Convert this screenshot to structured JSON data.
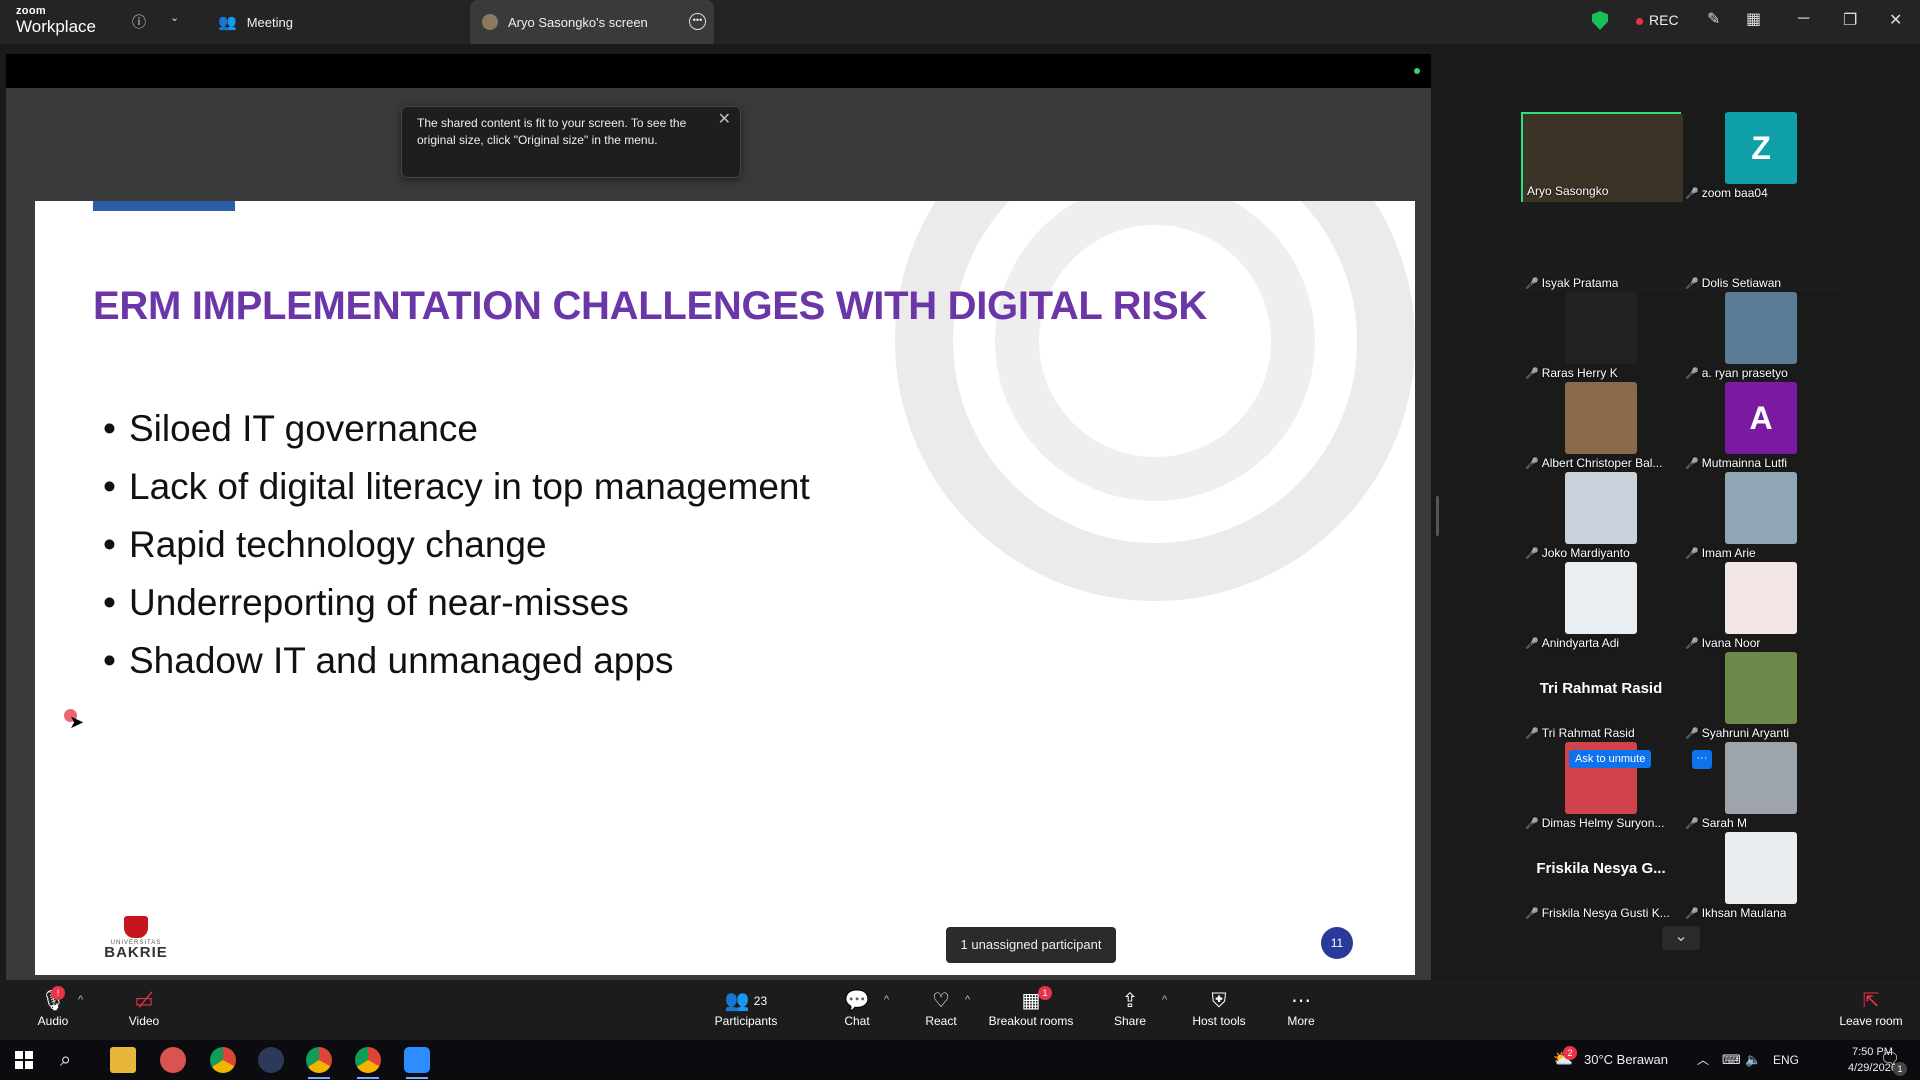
{
  "app": {
    "logo_line1": "zoom",
    "logo_line2": "Workplace",
    "info_icon": "info-icon",
    "tab_meeting": "Meeting",
    "tab_screen": "Aryo Sasongko's screen",
    "rec_label": "REC"
  },
  "toast": {
    "message": "The shared content is fit to your screen. To see the original size, click \"Original size\" in the menu."
  },
  "slide": {
    "title": "ERM IMPLEMENTATION CHALLENGES WITH DIGITAL RISK",
    "bullets": [
      "Siloed IT governance",
      "Lack of digital literacy in top management",
      "Rapid technology change",
      "Underreporting of near-misses",
      "Shadow IT and unmanaged apps"
    ],
    "logo_upper": "UNIVERSITAS",
    "logo_lower": "BAKRIE",
    "page_number": "11",
    "colors": {
      "title": "#6b36a8",
      "accent_bar": "#2e5da8"
    }
  },
  "gallery": {
    "participants": [
      {
        "name": "Aryo Sasongko",
        "active": true
      },
      {
        "name": "zoom baa04",
        "initial": "Z"
      },
      {
        "name": "Isyak Pratama"
      },
      {
        "name": "Dolis Setiawan"
      },
      {
        "name": "Raras Herry K"
      },
      {
        "name": "a. ryan prasetyo"
      },
      {
        "name": "Albert Christoper Bal..."
      },
      {
        "name": "Mutmainna Lutfi",
        "initial": "A"
      },
      {
        "name": "Joko Mardiyanto"
      },
      {
        "name": "Imam Arie"
      },
      {
        "name": "Anindyarta Adi"
      },
      {
        "name": "Ivana Noor"
      },
      {
        "name": "Tri Rahmat Rasid",
        "display_name": "Tri Rahmat Rasid"
      },
      {
        "name": "Syahruni Aryanti"
      },
      {
        "name": "Dimas Helmy Suryon..."
      },
      {
        "name": "Sarah M"
      },
      {
        "name": "Friskila Nesya Gusti K...",
        "display_name": "Friskila Nesya G..."
      },
      {
        "name": "Ikhsan Maulana"
      }
    ],
    "ask_to_unmute": "Ask to unmute",
    "more_dots": "···"
  },
  "unassigned": "1 unassigned participant",
  "toolbar": {
    "audio": "Audio",
    "video": "Video",
    "participants": "Participants",
    "participants_count": "23",
    "chat": "Chat",
    "react": "React",
    "breakout": "Breakout rooms",
    "breakout_badge": "1",
    "share": "Share",
    "host_tools": "Host tools",
    "more": "More",
    "leave": "Leave room"
  },
  "taskbar": {
    "weather": "30°C  Berawan",
    "language": "ENG",
    "time": "7:50 PM",
    "date": "4/29/2026",
    "notif_count": "1",
    "weather_badge": "2"
  }
}
